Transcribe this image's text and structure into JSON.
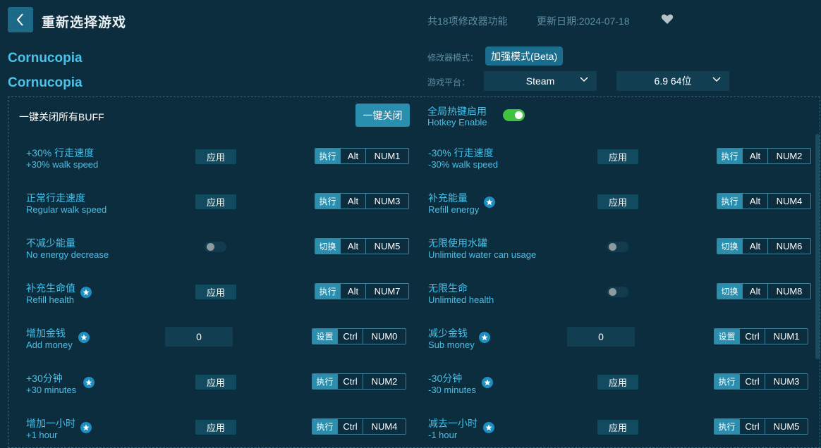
{
  "header": {
    "title": "重新选择游戏",
    "feature_count": "共18项修改器功能",
    "update_date": "更新日期:2024-07-18"
  },
  "game": {
    "name": "Cornucopia",
    "name_secondary": "Cornucopia"
  },
  "settings": {
    "mode_label": "修改器模式：",
    "mode_value": "加强模式(Beta)",
    "platform_label": "游戏平台：",
    "platform_value": "Steam",
    "version_value": "6.9 64位"
  },
  "toolbar": {
    "disable_all_label": "一键关闭所有BUFF",
    "disable_all_button": "一键关闭",
    "hotkey_title": "全局热键启用",
    "hotkey_subtitle": "Hotkey Enable",
    "hotkey_enabled": true
  },
  "features": [
    {
      "cn": "+30% 行走速度",
      "en": "+30% walk speed",
      "control": "apply",
      "label": "应用",
      "action": "执行",
      "mod": "Alt",
      "key": "NUM1",
      "star": false
    },
    {
      "cn": "-30% 行走速度",
      "en": "-30% walk speed",
      "control": "apply",
      "label": "应用",
      "action": "执行",
      "mod": "Alt",
      "key": "NUM2",
      "star": false
    },
    {
      "cn": "正常行走速度",
      "en": "Regular walk speed",
      "control": "apply",
      "label": "应用",
      "action": "执行",
      "mod": "Alt",
      "key": "NUM3",
      "star": false
    },
    {
      "cn": "补充能量",
      "en": "Refill energy",
      "control": "apply",
      "label": "应用",
      "action": "执行",
      "mod": "Alt",
      "key": "NUM4",
      "star": true
    },
    {
      "cn": "不减少能量",
      "en": "No energy decrease",
      "control": "toggle",
      "action": "切换",
      "mod": "Alt",
      "key": "NUM5",
      "star": false
    },
    {
      "cn": "无限使用水罐",
      "en": "Unlimited water can usage",
      "control": "toggle",
      "action": "切换",
      "mod": "Alt",
      "key": "NUM6",
      "star": false
    },
    {
      "cn": "补充生命值",
      "en": "Refill health",
      "control": "apply",
      "label": "应用",
      "action": "执行",
      "mod": "Alt",
      "key": "NUM7",
      "star": true
    },
    {
      "cn": "无限生命",
      "en": "Unlimited health",
      "control": "toggle",
      "action": "切换",
      "mod": "Alt",
      "key": "NUM8",
      "star": false
    },
    {
      "cn": "增加金钱",
      "en": "Add money",
      "control": "input",
      "value": "0",
      "action": "设置",
      "mod": "Ctrl",
      "key": "NUM0",
      "star": true
    },
    {
      "cn": "减少金钱",
      "en": "Sub money",
      "control": "input",
      "value": "0",
      "action": "设置",
      "mod": "Ctrl",
      "key": "NUM1",
      "star": true
    },
    {
      "cn": "+30分钟",
      "en": "+30 minutes",
      "control": "apply",
      "label": "应用",
      "action": "执行",
      "mod": "Ctrl",
      "key": "NUM2",
      "star": true
    },
    {
      "cn": "-30分钟",
      "en": "-30 minutes",
      "control": "apply",
      "label": "应用",
      "action": "执行",
      "mod": "Ctrl",
      "key": "NUM3",
      "star": true
    },
    {
      "cn": "增加一小时",
      "en": "+1 hour",
      "control": "apply",
      "label": "应用",
      "action": "执行",
      "mod": "Ctrl",
      "key": "NUM4",
      "star": true
    },
    {
      "cn": "减去一小时",
      "en": "-1 hour",
      "control": "apply",
      "label": "应用",
      "action": "执行",
      "mod": "Ctrl",
      "key": "NUM5",
      "star": true
    }
  ],
  "icons": {
    "back": "chevron-left-icon",
    "favorite": "heart-icon",
    "dropdown": "chevron-down-icon",
    "star": "star-badge-icon"
  },
  "colors": {
    "background": "#0c2d3e",
    "accent": "#2a8fae",
    "text_accent": "#46c0e8",
    "toggle_on": "#3fc341"
  }
}
